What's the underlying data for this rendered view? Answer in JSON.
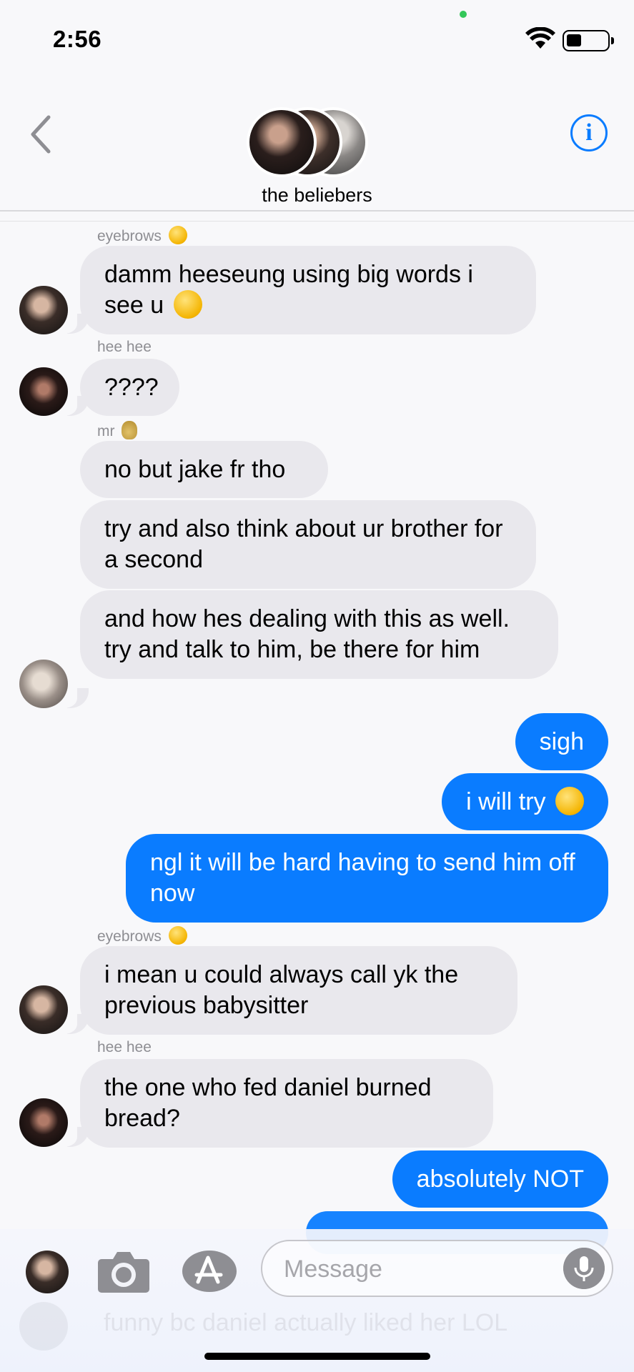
{
  "status_bar": {
    "time": "2:56"
  },
  "header": {
    "group_name": "the beliebers",
    "info_icon_glyph": "i"
  },
  "messages": [
    {
      "sender": "eyebrows",
      "direction": "in",
      "text": "damm heeseung using big words i see u"
    },
    {
      "sender": "hee hee",
      "direction": "in",
      "text": "????"
    },
    {
      "sender": "mr",
      "direction": "in",
      "text": "no but jake fr tho"
    },
    {
      "direction": "in",
      "text": "try and also think about ur brother for a second"
    },
    {
      "direction": "in",
      "text": "and how hes dealing with this as well. try and talk to him, be there for him"
    },
    {
      "direction": "out",
      "text": "sigh"
    },
    {
      "direction": "out",
      "text": "i will try"
    },
    {
      "direction": "out",
      "text": "ngl it will be hard having to send him off now"
    },
    {
      "sender": "eyebrows",
      "direction": "in",
      "text": "i mean u could always call yk the previous babysitter"
    },
    {
      "sender": "hee hee",
      "direction": "in",
      "text": "the one who fed daniel burned bread?"
    },
    {
      "direction": "out",
      "text": "absolutely NOT"
    }
  ],
  "ghost_message": "funny bc daniel actually liked her LOL",
  "input": {
    "placeholder": "Message"
  },
  "colors": {
    "outgoing": "#0a7cff",
    "incoming": "#e9e8ed",
    "accent": "#0a7cff"
  },
  "icons": [
    "back-chevron-icon",
    "info-icon",
    "camera-icon",
    "app-store-icon",
    "microphone-icon",
    "wifi-icon",
    "battery-icon"
  ]
}
